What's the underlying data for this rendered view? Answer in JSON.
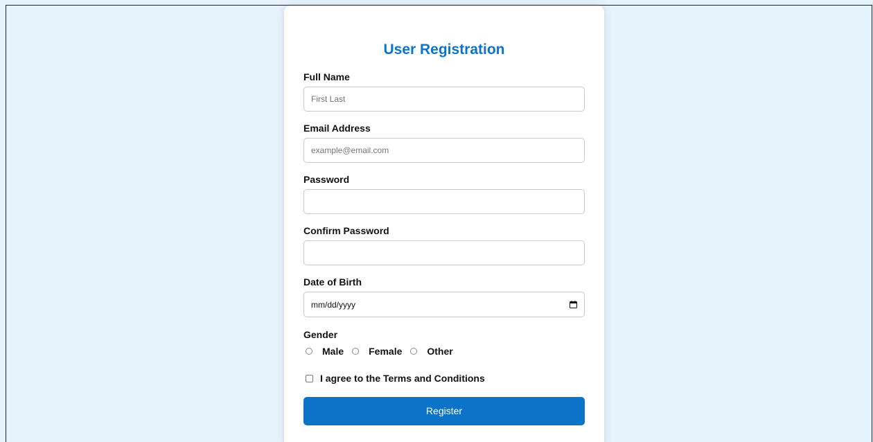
{
  "form": {
    "title": "User Registration",
    "full_name": {
      "label": "Full Name",
      "placeholder": "First Last",
      "value": ""
    },
    "email": {
      "label": "Email Address",
      "placeholder": "example@email.com",
      "value": ""
    },
    "password": {
      "label": "Password",
      "value": ""
    },
    "confirm_password": {
      "label": "Confirm Password",
      "value": ""
    },
    "dob": {
      "label": "Date of Birth",
      "value": "mm/dd/yyyy",
      "icon": "calendar-icon"
    },
    "gender": {
      "label": "Gender",
      "options": [
        "Male",
        "Female",
        "Other"
      ]
    },
    "terms": {
      "label": "I agree to the Terms and Conditions",
      "checked": false
    },
    "submit_label": "Register"
  },
  "colors": {
    "accent": "#0b74c9",
    "page_background": "#e6f2fc",
    "card_background": "#ffffff"
  }
}
